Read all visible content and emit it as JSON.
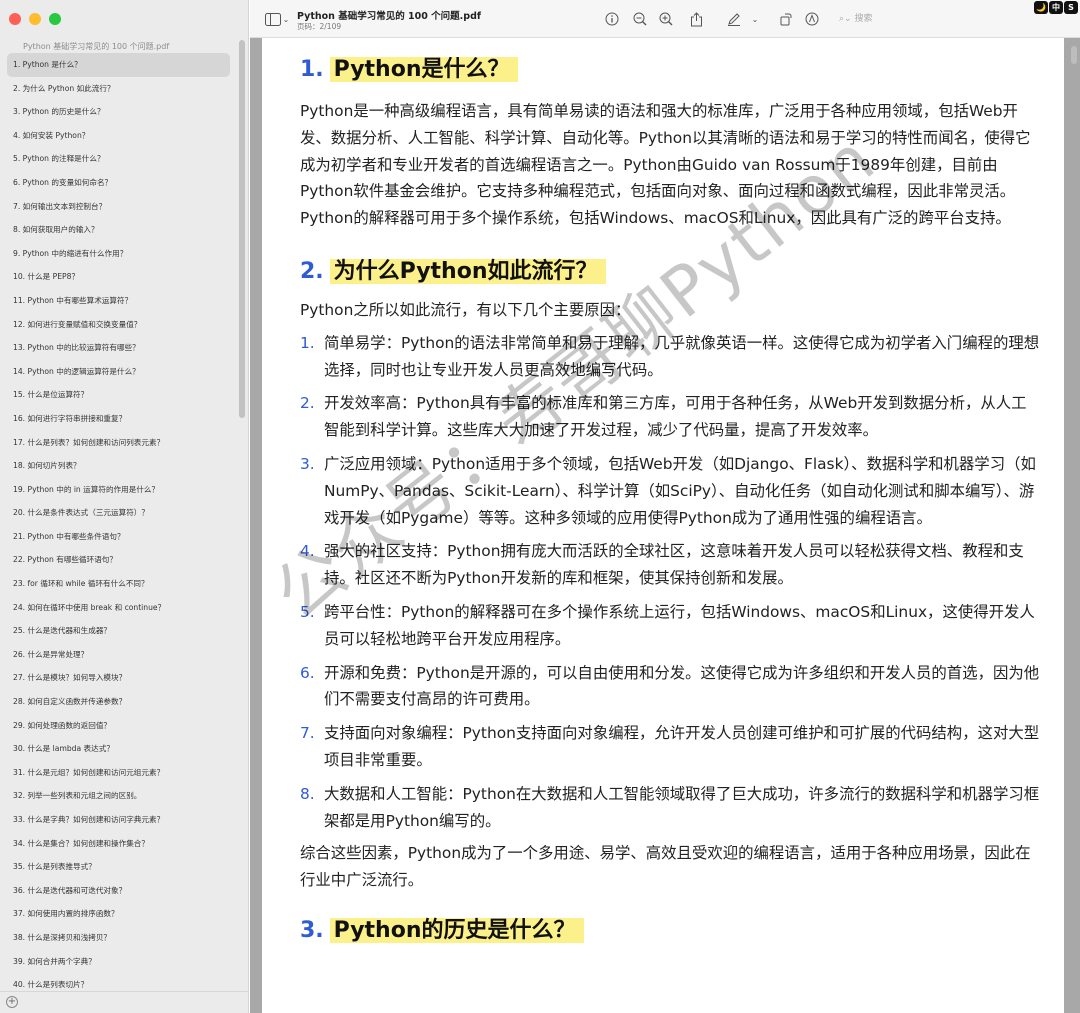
{
  "sidebar": {
    "title": "Python 基础学习常见的 100 个问题.pdf",
    "items": [
      "1. Python 是什么？",
      "2. 为什么 Python 如此流行？",
      "3. Python 的历史是什么？",
      "4. 如何安装 Python？",
      "5. Python 的注释是什么？",
      "6. Python 的变量如何命名？",
      "7. 如何输出文本到控制台？",
      "8. 如何获取用户的输入？",
      "9. Python 中的缩进有什么作用？",
      "10. 什么是 PEP8？",
      "11. Python 中有哪些算术运算符？",
      "12. 如何进行变量赋值和交换变量值？",
      "13. Python 中的比较运算符有哪些？",
      "14. Python 中的逻辑运算符是什么？",
      "15. 什么是位运算符？",
      "16. 如何进行字符串拼接和重复？",
      "17. 什么是列表？如何创建和访问列表元素？",
      "18. 如何切片列表？",
      "19. Python 中的 in 运算符的作用是什么？",
      "20. 什么是条件表达式（三元运算符）？",
      "21. Python 中有哪些条件语句？",
      "22. Python 有哪些循环语句？",
      "23. for 循环和 while 循环有什么不同？",
      "24. 如何在循环中使用 break 和 continue？",
      "25. 什么是迭代器和生成器？",
      "26. 什么是异常处理？",
      "27. 什么是模块？如何导入模块？",
      "28. 如何自定义函数并传递参数？",
      "29. 如何处理函数的返回值？",
      "30. 什么是 lambda 表达式？",
      "31. 什么是元组？如何创建和访问元组元素？",
      "32. 列举一些列表和元组之间的区别。",
      "33. 什么是字典？如何创建和访问字典元素？",
      "34. 什么是集合？如何创建和操作集合？",
      "35. 什么是列表推导式？",
      "36. 什么是迭代器和可迭代对象？",
      "37. 如何使用内置的排序函数？",
      "38. 什么是深拷贝和浅拷贝？",
      "39. 如何合并两个字典？",
      "40. 什么是列表切片？"
    ]
  },
  "toolbar": {
    "doc_title": "Python 基础学习常见的 100 个问题.pdf",
    "page_info": "页码：2/109",
    "search_placeholder": "搜索",
    "badges": [
      "🌙",
      "中",
      "S"
    ]
  },
  "doc": {
    "s1": {
      "num": "1.",
      "title": "Python是什么？",
      "body": "Python是一种高级编程语言，具有简单易读的语法和强大的标准库，广泛用于各种应用领域，包括Web开发、数据分析、人工智能、科学计算、自动化等。Python以其清晰的语法和易于学习的特性而闻名，使得它成为初学者和专业开发者的首选编程语言之一。Python由Guido van Rossum于1989年创建，目前由Python软件基金会维护。它支持多种编程范式，包括面向对象、面向过程和函数式编程，因此非常灵活。 Python的解释器可用于多个操作系统，包括Windows、macOS和Linux，因此具有广泛的跨平台支持。"
    },
    "s2": {
      "num": "2.",
      "title": "为什么Python如此流行？",
      "intro": "Python之所以如此流行，有以下几个主要原因：",
      "items": [
        {
          "n": "1.",
          "text": "简单易学：Python的语法非常简单和易于理解，几乎就像英语一样。这使得它成为初学者入门编程的理想选择，同时也让专业开发人员更高效地编写代码。"
        },
        {
          "n": "2.",
          "text": "开发效率高：Python具有丰富的标准库和第三方库，可用于各种任务，从Web开发到数据分析，从人工智能到科学计算。这些库大大加速了开发过程，减少了代码量，提高了开发效率。"
        },
        {
          "n": "3.",
          "text": "广泛应用领域：Python适用于多个领域，包括Web开发（如Django、Flask）、数据科学和机器学习（如NumPy、Pandas、Scikit-Learn）、科学计算（如SciPy）、自动化任务（如自动化测试和脚本编写）、游戏开发（如Pygame）等等。这种多领域的应用使得Python成为了通用性强的编程语言。"
        },
        {
          "n": "4.",
          "text": "强大的社区支持：Python拥有庞大而活跃的全球社区，这意味着开发人员可以轻松获得文档、教程和支持。社区还不断为Python开发新的库和框架，使其保持创新和发展。"
        },
        {
          "n": "5.",
          "text": "跨平台性：Python的解释器可在多个操作系统上运行，包括Windows、macOS和Linux，这使得开发人员可以轻松地跨平台开发应用程序。"
        },
        {
          "n": "6.",
          "text": "开源和免费：Python是开源的，可以自由使用和分发。这使得它成为许多组织和开发人员的首选，因为他们不需要支付高昂的许可费用。"
        },
        {
          "n": "7.",
          "text": "支持面向对象编程：Python支持面向对象编程，允许开发人员创建可维护和可扩展的代码结构，这对大型项目非常重要。"
        },
        {
          "n": "8.",
          "text": "大数据和人工智能：Python在大数据和人工智能领域取得了巨大成功，许多流行的数据科学和机器学习框架都是用Python编写的。"
        }
      ],
      "outro": "综合这些因素，Python成为了一个多用途、易学、高效且受欢迎的编程语言，适用于各种应用场景，因此在行业中广泛流行。"
    },
    "s3": {
      "num": "3.",
      "title": "Python的历史是什么？"
    },
    "watermark": "公众号：寿哥聊Python"
  }
}
